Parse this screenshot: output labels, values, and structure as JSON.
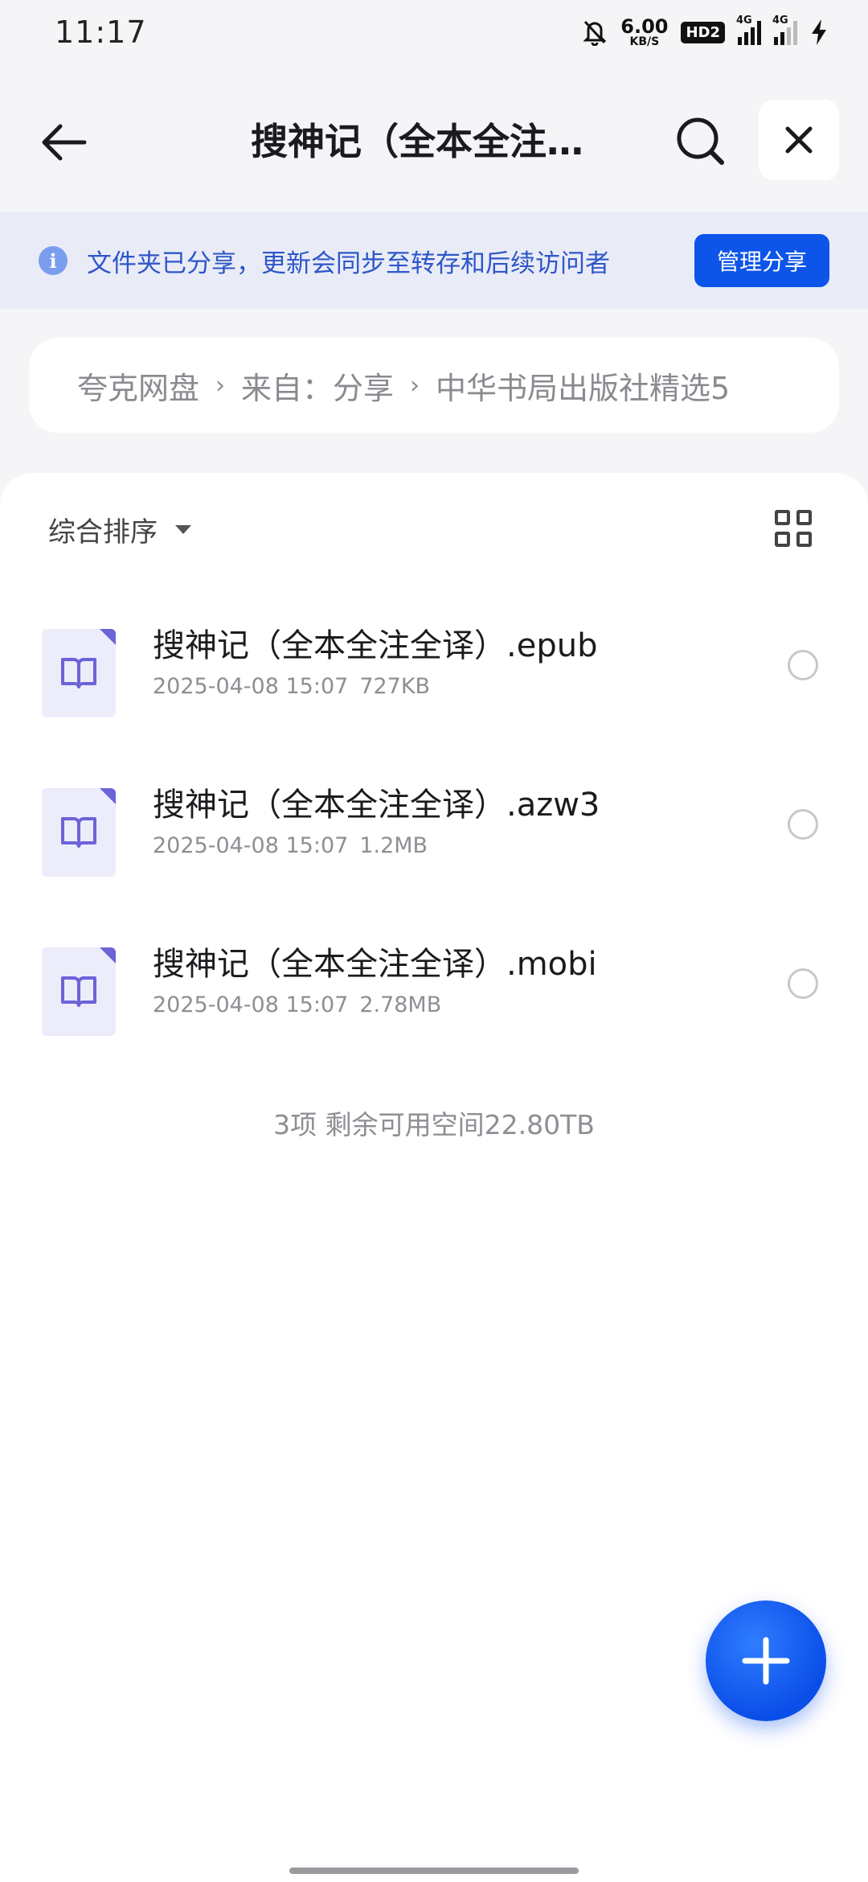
{
  "status_bar": {
    "time": "11:17",
    "net_speed_value": "6.00",
    "net_speed_unit": "KB/S",
    "hd_badge": "HD2",
    "signal1_label": "4G",
    "signal2_label": "4G"
  },
  "header": {
    "title": "搜神记（全本全注…",
    "icons": [
      "back-arrow-icon",
      "search-icon",
      "close-icon"
    ]
  },
  "share_banner": {
    "text": "文件夹已分享，更新会同步至转存和后续访问者",
    "button_label": "管理分享"
  },
  "breadcrumb": {
    "items": [
      "夸克网盘",
      "来自：分享",
      "中华书局出版社精选5"
    ],
    "separator": "›"
  },
  "toolbar": {
    "sort_label": "综合排序"
  },
  "files": [
    {
      "name": "搜神记（全本全注全译）.epub",
      "date": "2025-04-08 15:07",
      "size": "727KB"
    },
    {
      "name": "搜神记（全本全注全译）.azw3",
      "date": "2025-04-08 15:07",
      "size": "1.2MB"
    },
    {
      "name": "搜神记（全本全注全译）.mobi",
      "date": "2025-04-08 15:07",
      "size": "2.78MB"
    }
  ],
  "footer": {
    "summary": "3项 剩余可用空间22.80TB"
  },
  "colors": {
    "accent": "#0d55e8",
    "banner_bg": "#e9ecf7",
    "banner_text": "#2e56c9",
    "book_icon": "#6c63d8"
  }
}
